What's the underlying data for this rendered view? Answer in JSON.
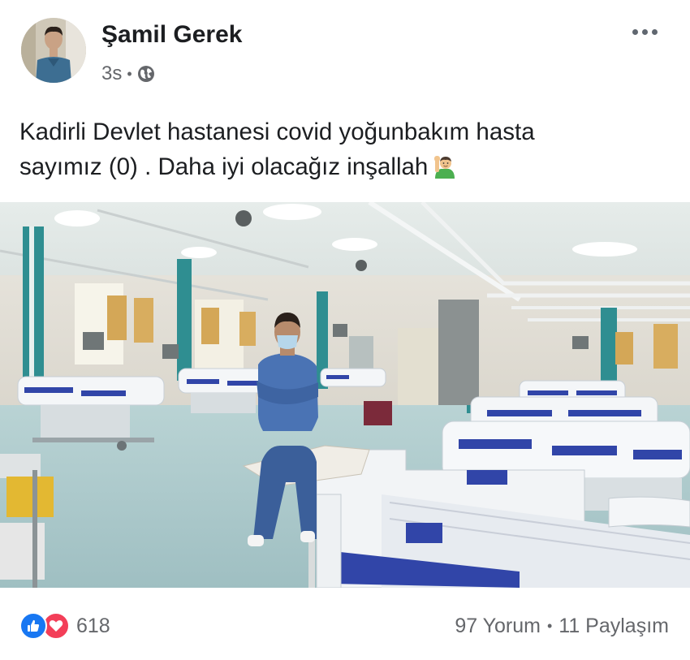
{
  "post": {
    "author": "Şamil Gerek",
    "timestamp": "3s",
    "separator": "•",
    "audience_icon": "globe-icon",
    "more_icon": "more-options-icon",
    "text_lines": [
      "Kadirli Devlet hastanesi covid yoğunbakım hasta",
      "sayımız (0) . Daha iyi olacağız inşallah"
    ],
    "emoji": "raising-hand-man-emoji",
    "photo": "empty-icu-ward-with-doctor-photo"
  },
  "footer": {
    "reaction_icons": [
      "like-reaction-icon",
      "love-reaction-icon"
    ],
    "reaction_count": "618",
    "comments": "97 Yorum",
    "separator": "•",
    "shares": "11 Paylaşım"
  },
  "colors": {
    "like": "#1877f2",
    "love": "#f33e58",
    "secondary_text": "#65676b",
    "primary_text": "#1c1e21"
  }
}
